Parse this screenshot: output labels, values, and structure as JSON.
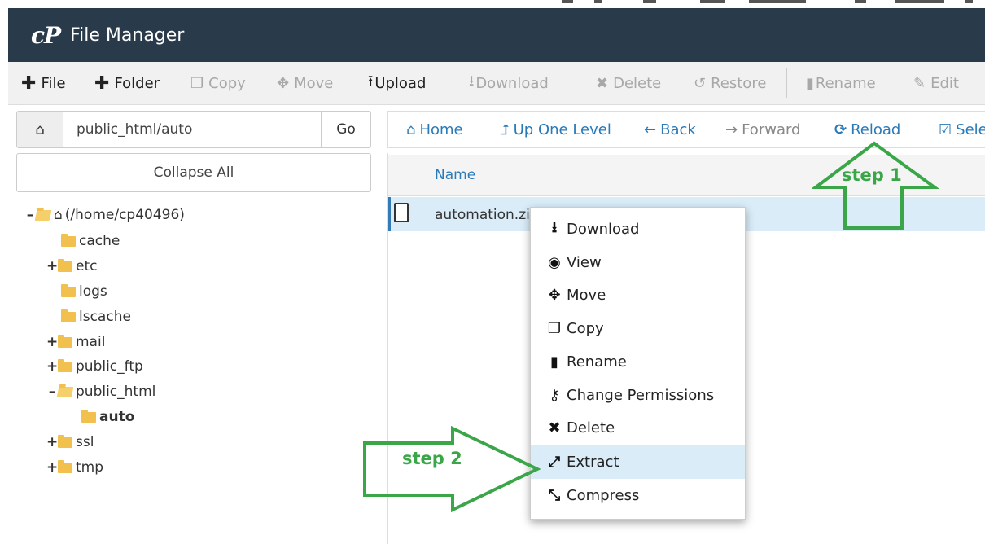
{
  "header": {
    "logo": "cP",
    "title": "File Manager"
  },
  "toolbar": {
    "items": [
      {
        "label": "File",
        "icon": "plus-icon"
      },
      {
        "label": "Folder",
        "icon": "plus-icon"
      },
      {
        "label": "Copy",
        "icon": "copy-icon"
      },
      {
        "label": "Move",
        "icon": "move-icon"
      },
      {
        "label": "Upload",
        "icon": "upload-icon"
      },
      {
        "label": "Download",
        "icon": "download-icon"
      },
      {
        "label": "Delete",
        "icon": "close-icon"
      },
      {
        "label": "Restore",
        "icon": "undo-icon"
      },
      {
        "label": "Rename",
        "icon": "file-icon"
      },
      {
        "label": "Edit",
        "icon": "pencil-icon"
      }
    ]
  },
  "pathbar": {
    "value": "public_html/auto",
    "go_label": "Go"
  },
  "collapse_label": "Collapse All",
  "tree": {
    "root": "(/home/cp40496)",
    "items": [
      "cache",
      "etc",
      "logs",
      "lscache",
      "mail",
      "public_ftp",
      "public_html",
      "auto",
      "ssl",
      "tmp"
    ]
  },
  "nav": {
    "home": "Home",
    "up": "Up One Level",
    "back": "Back",
    "forward": "Forward",
    "reload": "Reload",
    "select": "Sele"
  },
  "files": {
    "column_name": "Name",
    "rows": [
      {
        "name": "automation.zi"
      }
    ]
  },
  "context_menu": {
    "items": [
      "Download",
      "View",
      "Move",
      "Copy",
      "Rename",
      "Change Permissions",
      "Delete",
      "Extract",
      "Compress"
    ]
  },
  "annotations": {
    "step1": "step 1",
    "step2": "step 2"
  },
  "colors": {
    "header_bg": "#293a4a",
    "accent": "#2a7ab8",
    "highlight": "#d9ecf8",
    "annotation": "#3aa648"
  }
}
